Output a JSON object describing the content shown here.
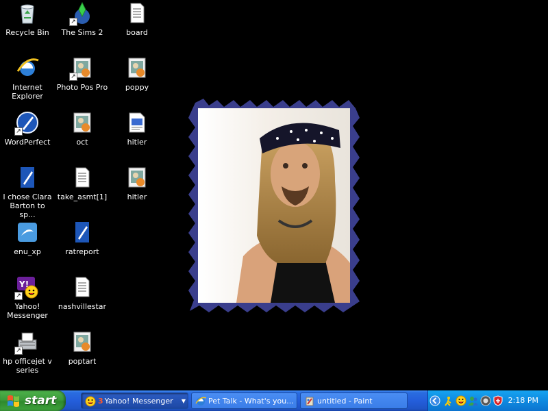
{
  "desktop": {
    "icons": [
      {
        "label": "Recycle Bin",
        "icon": "recycle-bin-icon"
      },
      {
        "label": "The Sims 2",
        "icon": "sims-icon"
      },
      {
        "label": "board",
        "icon": "text-document-icon"
      },
      {
        "label": "Internet Explorer",
        "icon": "internet-explorer-icon"
      },
      {
        "label": "Photo Pos Pro",
        "icon": "image-file-icon"
      },
      {
        "label": "poppy",
        "icon": "image-file-icon"
      },
      {
        "label": "WordPerfect",
        "icon": "wordperfect-icon"
      },
      {
        "label": "oct",
        "icon": "image-file-icon"
      },
      {
        "label": "hitler",
        "icon": "web-page-icon"
      },
      {
        "label": "I chose Clara Barton to sp...",
        "icon": "wordperfect-document-icon"
      },
      {
        "label": "take_asmt[1]",
        "icon": "text-document-icon"
      },
      {
        "label": "hitler",
        "icon": "image-file-icon"
      },
      {
        "label": "enu_xp",
        "icon": "installer-icon"
      },
      {
        "label": "ratreport",
        "icon": "wordperfect-document-icon"
      },
      {
        "label": "Yahoo! Messenger",
        "icon": "yahoo-messenger-icon"
      },
      {
        "label": "nashvillestar",
        "icon": "text-document-icon"
      },
      {
        "label": "hp officejet v series",
        "icon": "printer-icon"
      },
      {
        "label": "poptart",
        "icon": "image-file-icon"
      }
    ]
  },
  "taskbar": {
    "start_label": "start",
    "tasks": [
      {
        "count": "3",
        "label": "Yahoo! Messenger",
        "icon": "yahoo-smiley-icon"
      },
      {
        "label": "Pet Talk - What's you...",
        "icon": "internet-explorer-icon"
      },
      {
        "label": "untitled - Paint",
        "icon": "paint-icon"
      }
    ],
    "clock": "2:18 PM"
  }
}
